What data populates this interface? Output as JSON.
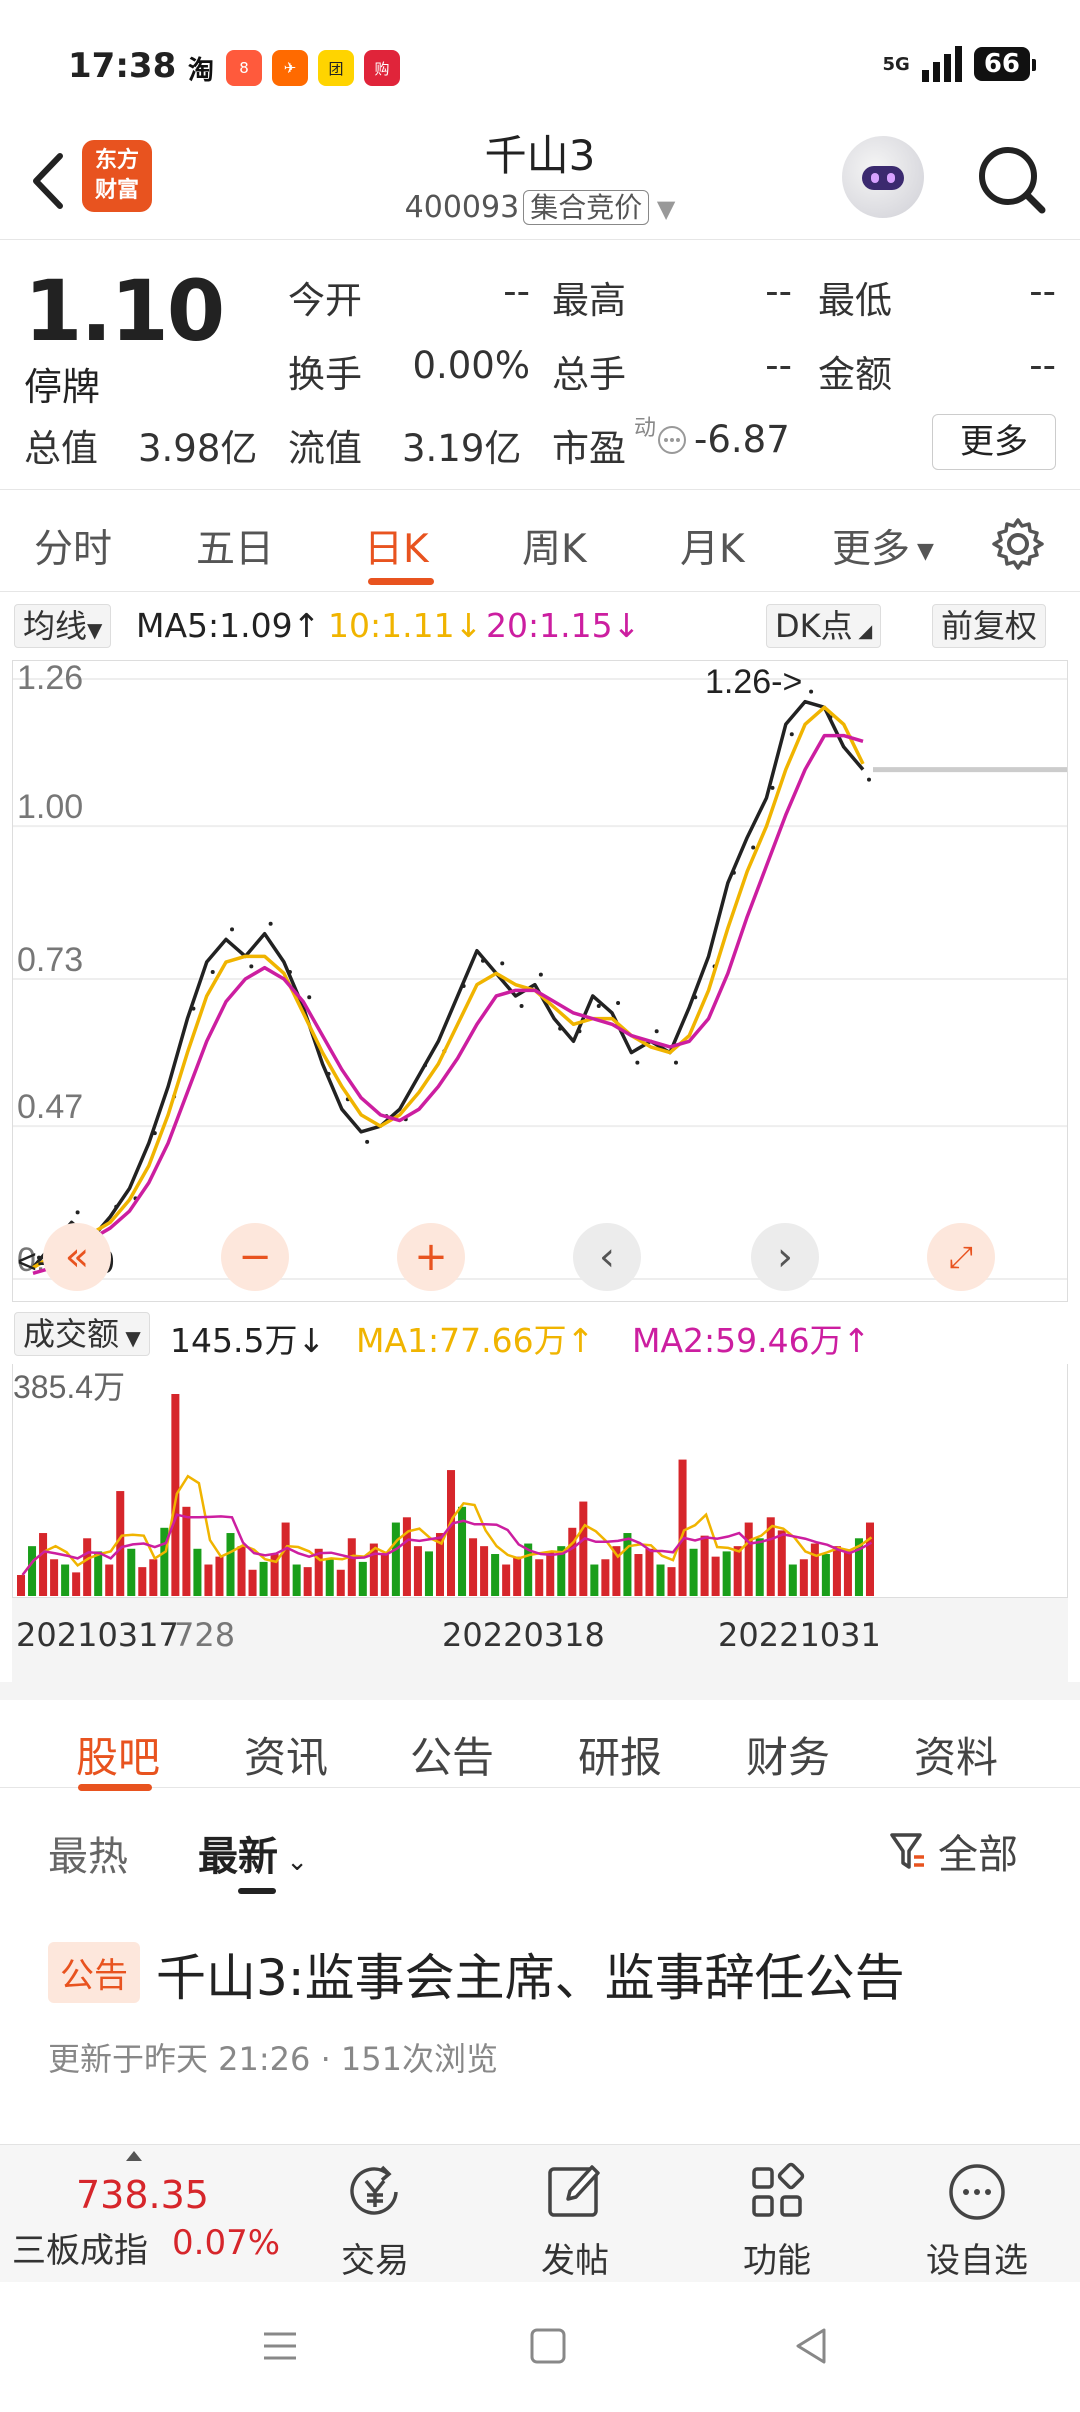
{
  "status_bar": {
    "time": "17:38",
    "apps": [
      "淘",
      "8",
      "✈",
      "团",
      "购"
    ],
    "network": "5G",
    "battery": "66"
  },
  "header": {
    "logo_line1": "东方",
    "logo_line2": "财富",
    "stock_name": "千山3",
    "stock_code": "400093",
    "auction_tag": "集合竞价"
  },
  "quote": {
    "price": "1.10",
    "status": "停牌",
    "open_label": "今开",
    "open_value": "--",
    "high_label": "最高",
    "high_value": "--",
    "low_label": "最低",
    "low_value": "--",
    "turnover_label": "换手",
    "turnover_value": "0.00%",
    "volume_label": "总手",
    "volume_value": "--",
    "amount_label": "金额",
    "amount_value": "--",
    "mktcap_label": "总值",
    "mktcap_value": "3.98亿",
    "float_label": "流值",
    "float_value": "3.19亿",
    "pe_label": "市盈",
    "pe_badge": "动",
    "pe_value": "-6.87",
    "more_button": "更多"
  },
  "period_tabs": [
    "分时",
    "五日",
    "日K",
    "周K",
    "月K",
    "更多"
  ],
  "chart_toolbar": {
    "indicator": "均线",
    "ma5": "MA5:1.09↑",
    "ma10": "10:1.11↓",
    "ma20": "20:1.15↓",
    "dk_button": "DK点",
    "adjust_button": "前复权"
  },
  "colors": {
    "accent": "#e8531f",
    "up": "#d6262b",
    "down": "#1a9e1a",
    "ma5": "#222222",
    "ma10": "#f0b400",
    "ma20": "#cc1ea0"
  },
  "chart_data": [
    {
      "type": "line",
      "y_ticks": [
        "1.26",
        "1.00",
        "0.73",
        "0.47",
        "0.20"
      ],
      "ylim": [
        0.2,
        1.26
      ],
      "annotations": {
        "high": "1.26->",
        "low": "<-0.20"
      },
      "last_price_line": 1.1,
      "x_dates": [
        "20210317",
        "728",
        "20220318",
        "20221031"
      ],
      "series": [
        {
          "name": "MA5",
          "values": [
            0.22,
            0.26,
            0.3,
            0.27,
            0.31,
            0.36,
            0.44,
            0.54,
            0.66,
            0.76,
            0.8,
            0.77,
            0.81,
            0.76,
            0.68,
            0.58,
            0.5,
            0.46,
            0.47,
            0.5,
            0.56,
            0.62,
            0.7,
            0.78,
            0.74,
            0.7,
            0.72,
            0.66,
            0.62,
            0.7,
            0.67,
            0.6,
            0.62,
            0.6,
            0.68,
            0.77,
            0.9,
            0.98,
            1.05,
            1.18,
            1.22,
            1.21,
            1.14,
            1.1
          ]
        },
        {
          "name": "MA10",
          "values": [
            0.22,
            0.24,
            0.28,
            0.28,
            0.3,
            0.34,
            0.4,
            0.49,
            0.6,
            0.7,
            0.76,
            0.77,
            0.77,
            0.74,
            0.67,
            0.6,
            0.54,
            0.49,
            0.47,
            0.49,
            0.53,
            0.58,
            0.65,
            0.72,
            0.74,
            0.72,
            0.71,
            0.68,
            0.65,
            0.66,
            0.66,
            0.63,
            0.61,
            0.6,
            0.63,
            0.71,
            0.82,
            0.92,
            1.0,
            1.1,
            1.18,
            1.21,
            1.18,
            1.11
          ]
        },
        {
          "name": "MA20",
          "values": [
            0.21,
            0.22,
            0.25,
            0.27,
            0.29,
            0.32,
            0.37,
            0.44,
            0.53,
            0.62,
            0.69,
            0.73,
            0.75,
            0.73,
            0.69,
            0.63,
            0.57,
            0.52,
            0.49,
            0.48,
            0.5,
            0.54,
            0.59,
            0.65,
            0.7,
            0.71,
            0.71,
            0.69,
            0.67,
            0.66,
            0.65,
            0.63,
            0.62,
            0.61,
            0.62,
            0.66,
            0.74,
            0.84,
            0.93,
            1.02,
            1.1,
            1.16,
            1.16,
            1.15
          ]
        }
      ]
    },
    {
      "type": "bar",
      "max_label": "385.4万",
      "series": [
        {
          "name": "成交额",
          "values": [
            40,
            95,
            120,
            70,
            60,
            45,
            110,
            85,
            60,
            200,
            90,
            55,
            70,
            130,
            385,
            170,
            90,
            60,
            75,
            120,
            95,
            50,
            65,
            80,
            140,
            60,
            55,
            90,
            70,
            50,
            110,
            65,
            100,
            80,
            140,
            150,
            95,
            85,
            120,
            240,
            170,
            110,
            95,
            80,
            60,
            75,
            100,
            70,
            85,
            95,
            130,
            180,
            60,
            70,
            95,
            120,
            80,
            90,
            60,
            55,
            260,
            90,
            115,
            75,
            85,
            95,
            140,
            110,
            150,
            125,
            60,
            70,
            100,
            80,
            95,
            85,
            110,
            140
          ]
        }
      ]
    }
  ],
  "chart_controls": {
    "prev_label": "‹",
    "next_label": "›"
  },
  "volume_toolbar": {
    "indicator": "成交额",
    "value": "145.5万↓",
    "ma1": "MA1:77.66万↑",
    "ma2": "MA2:59.46万↑"
  },
  "section_tabs": [
    "股吧",
    "资讯",
    "公告",
    "研报",
    "财务",
    "资料"
  ],
  "sort": {
    "hot": "最热",
    "latest": "最新",
    "filter": "全部"
  },
  "post": {
    "badge": "公告",
    "title": "千山3:监事会主席、监事辞任公告",
    "meta": "更新于昨天 21:26 · 151次浏览"
  },
  "bottom_nav": {
    "index_value": "738.35",
    "index_name": "三板成指",
    "index_change": "0.07%",
    "items": [
      "交易",
      "发帖",
      "功能",
      "设自选"
    ]
  }
}
